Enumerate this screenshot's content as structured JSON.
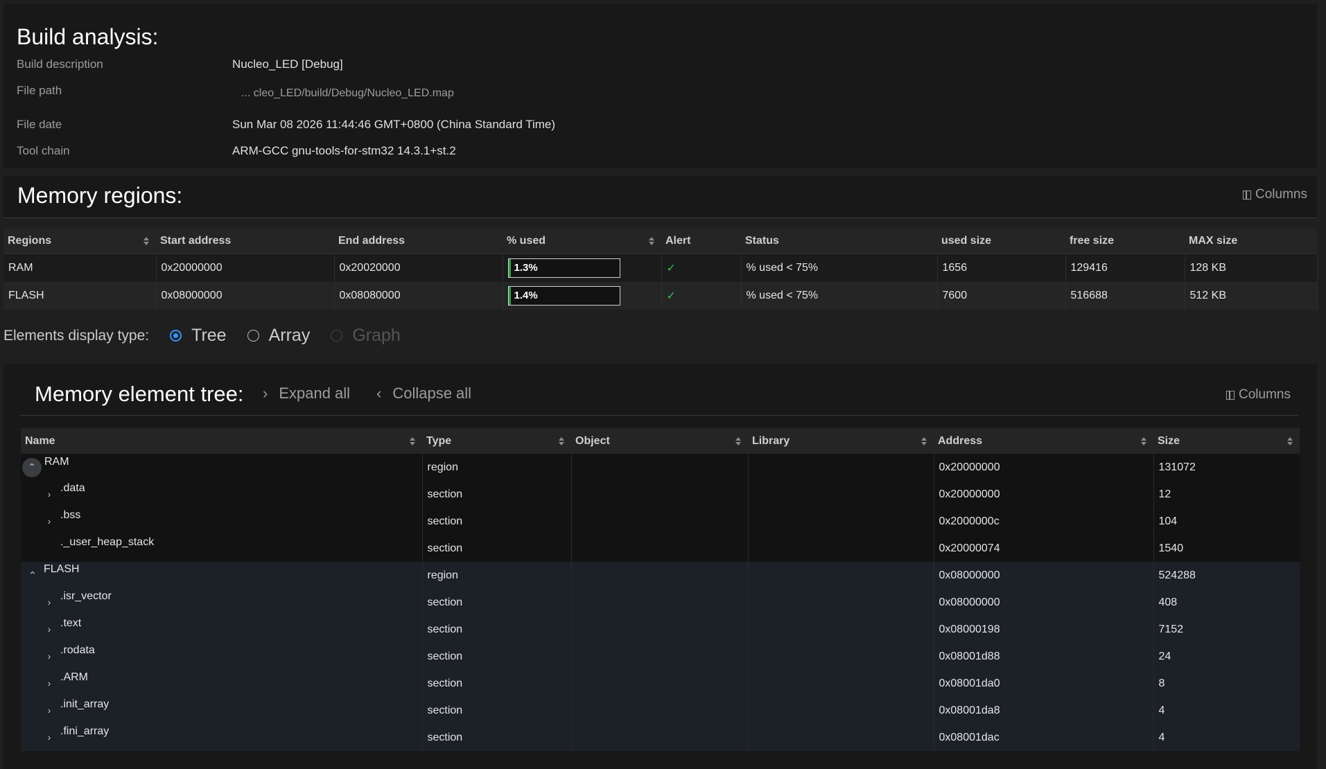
{
  "build": {
    "title": "Build analysis:",
    "rows": [
      {
        "label": "Build description",
        "value": "Nucleo_LED [Debug]"
      },
      {
        "label": "File path",
        "value": "... cleo_LED/build/Debug/Nucleo_LED.map"
      },
      {
        "label": "File date",
        "value": "Sun Mar 08 2026 11:44:46 GMT+0800 (China Standard Time)"
      },
      {
        "label": "Tool chain",
        "value": "ARM-GCC gnu-tools-for-stm32 14.3.1+st.2"
      }
    ]
  },
  "regions": {
    "title": "Memory regions:",
    "columns_label": "Columns",
    "headers": [
      "Regions",
      "Start address",
      "End address",
      "% used",
      "Alert",
      "Status",
      "used size",
      "free size",
      "MAX size"
    ],
    "rows": [
      {
        "region": "RAM",
        "start": "0x20000000",
        "end": "0x20020000",
        "pct": "1.3%",
        "pct_value": 1.3,
        "status": "% used < 75%",
        "used": "1656",
        "free": "129416",
        "max": "128 KB"
      },
      {
        "region": "FLASH",
        "start": "0x08000000",
        "end": "0x08080000",
        "pct": "1.4%",
        "pct_value": 1.4,
        "status": "% used < 75%",
        "used": "7600",
        "free": "516688",
        "max": "512 KB"
      }
    ],
    "alert_icon": "check-icon",
    "alert_color": "#3fb950"
  },
  "display": {
    "label": "Elements display type:",
    "options": [
      {
        "label": "Tree",
        "selected": true,
        "disabled": false
      },
      {
        "label": "Array",
        "selected": false,
        "disabled": false
      },
      {
        "label": "Graph",
        "selected": false,
        "disabled": true
      }
    ]
  },
  "tree": {
    "title": "Memory element tree:",
    "expand_all": "Expand all",
    "collapse_all": "Collapse all",
    "columns_label": "Columns",
    "headers": [
      "Name",
      "Type",
      "Object",
      "Library",
      "Address",
      "Size"
    ],
    "rows": [
      {
        "name": "RAM",
        "type": "region",
        "object": "",
        "library": "",
        "address": "0x20000000",
        "size": "131072"
      },
      {
        "name": ".data",
        "type": "section",
        "object": "",
        "library": "",
        "address": "0x20000000",
        "size": "12"
      },
      {
        "name": ".bss",
        "type": "section",
        "object": "",
        "library": "",
        "address": "0x2000000c",
        "size": "104"
      },
      {
        "name": "._user_heap_stack",
        "type": "section",
        "object": "",
        "library": "",
        "address": "0x20000074",
        "size": "1540"
      },
      {
        "name": "FLASH",
        "type": "region",
        "object": "",
        "library": "",
        "address": "0x08000000",
        "size": "524288"
      },
      {
        "name": ".isr_vector",
        "type": "section",
        "object": "",
        "library": "",
        "address": "0x08000000",
        "size": "408"
      },
      {
        "name": ".text",
        "type": "section",
        "object": "",
        "library": "",
        "address": "0x08000198",
        "size": "7152"
      },
      {
        "name": ".rodata",
        "type": "section",
        "object": "",
        "library": "",
        "address": "0x08001d88",
        "size": "24"
      },
      {
        "name": ".ARM",
        "type": "section",
        "object": "",
        "library": "",
        "address": "0x08001da0",
        "size": "8"
      },
      {
        "name": ".init_array",
        "type": "section",
        "object": "",
        "library": "",
        "address": "0x08001da8",
        "size": "4"
      },
      {
        "name": ".fini_array",
        "type": "section",
        "object": "",
        "library": "",
        "address": "0x08001dac",
        "size": "4"
      }
    ]
  },
  "colors": {
    "accent": "#3794ff",
    "ok": "#3fb950",
    "flash_row_bg": "#1c2128"
  }
}
